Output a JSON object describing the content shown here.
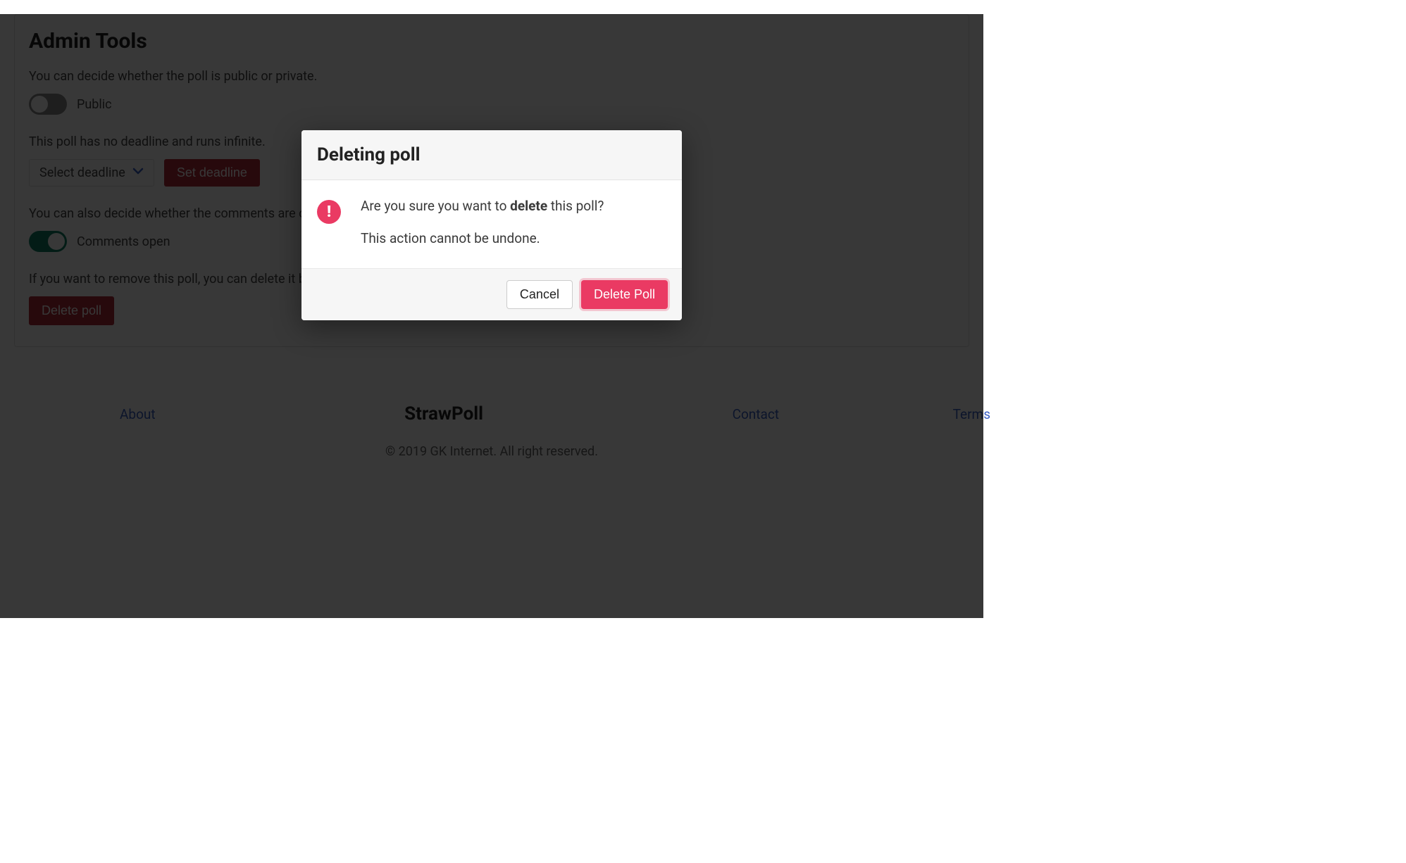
{
  "admin": {
    "title": "Admin Tools",
    "visibility_text": "You can decide whether the poll is public or private.",
    "public_toggle_label": "Public",
    "deadline_text": "This poll has no deadline and runs infinite.",
    "deadline_select_label": "Select deadline",
    "set_deadline_btn": "Set deadline",
    "comments_text": "You can also decide whether the comments are open.",
    "comments_toggle_label": "Comments open",
    "remove_text": "If you want to remove this poll, you can delete it below.",
    "delete_btn": "Delete poll"
  },
  "footer": {
    "about": "About",
    "brand": "StrawPoll",
    "contact": "Contact",
    "terms": "Terms",
    "copyright": "© 2019 GK Internet. All right reserved."
  },
  "modal": {
    "title": "Deleting poll",
    "line1_pre": "Are you sure you want to ",
    "line1_bold": "delete",
    "line1_post": " this poll?",
    "line2": "This action cannot be undone.",
    "cancel": "Cancel",
    "confirm": "Delete Poll"
  }
}
